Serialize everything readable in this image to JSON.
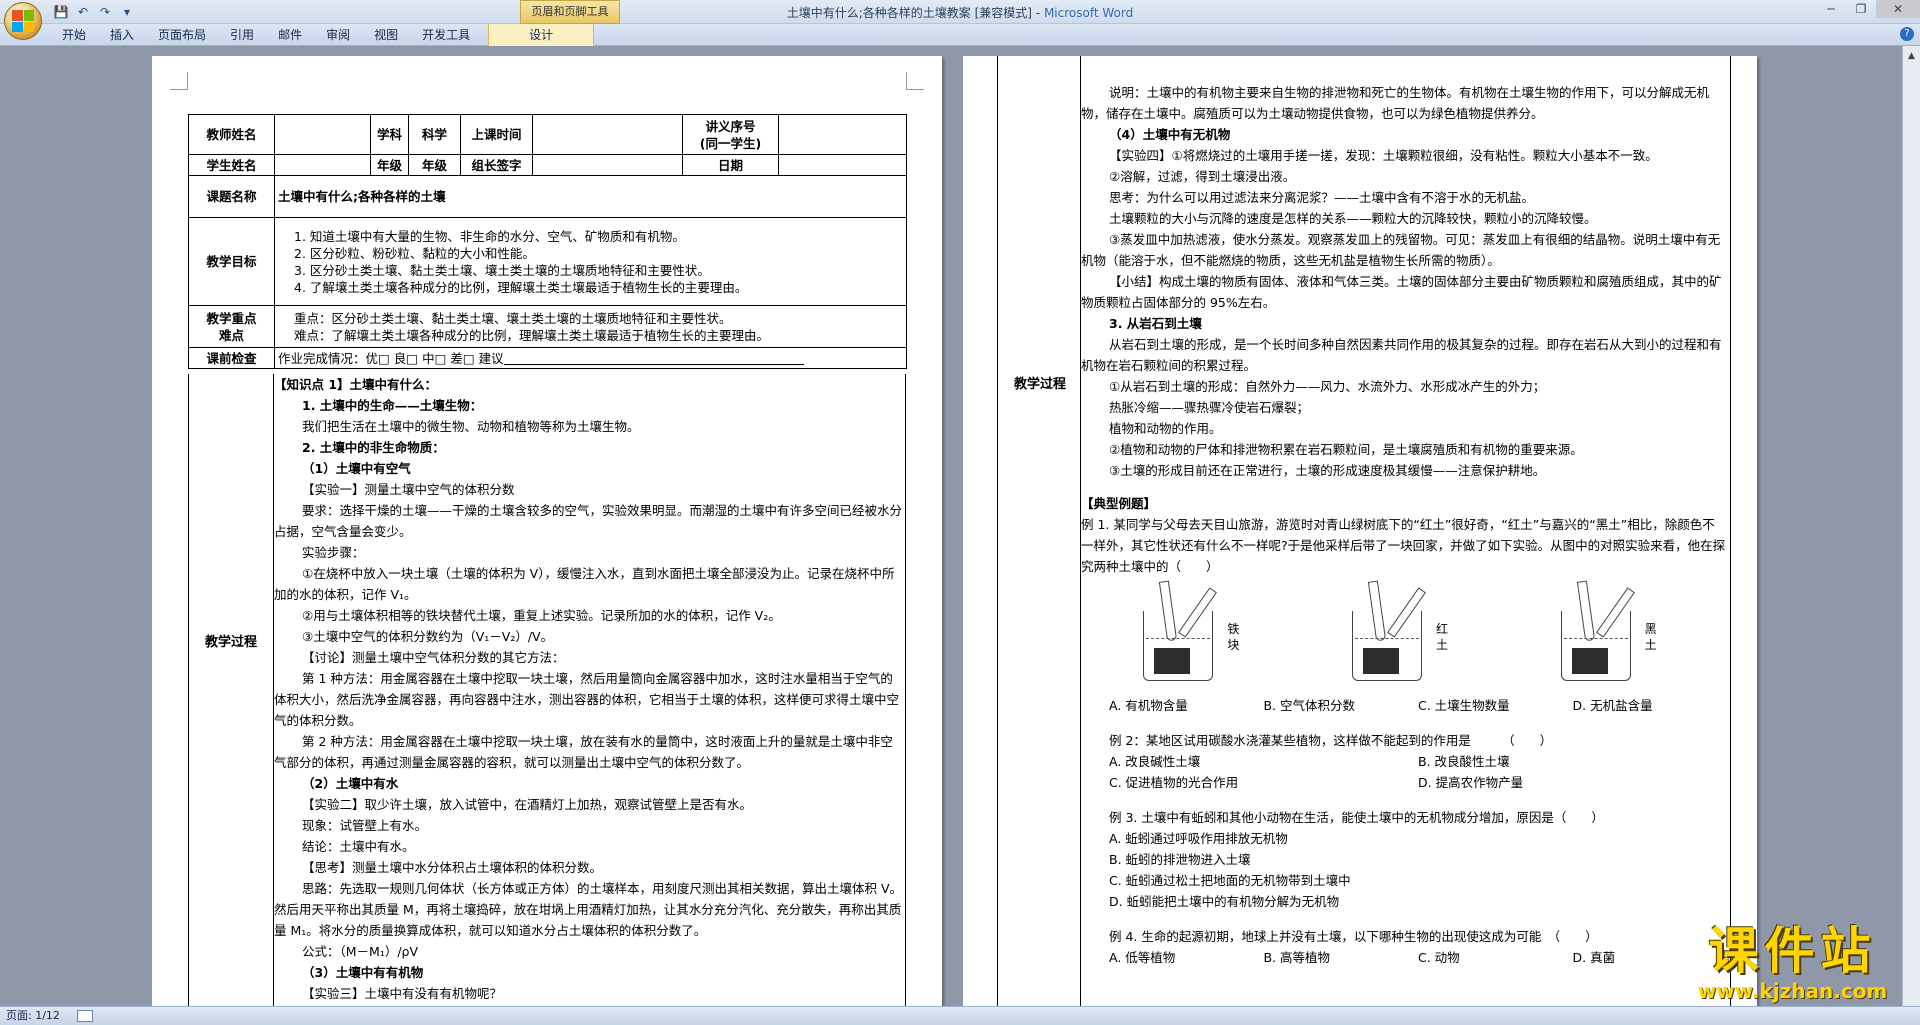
{
  "window": {
    "title": "土壤中有什么;各种各样的土壤教案 [兼容模式]",
    "app_name": "Microsoft Word",
    "separator": " - ",
    "context_group": "页眉和页脚工具",
    "controls": {
      "minimize": "─",
      "restore": "❐",
      "close": "✕"
    }
  },
  "qat": {
    "save": "💾",
    "undo": "↶",
    "redo": "↷",
    "more": "▾"
  },
  "ribbon": {
    "tabs": [
      "开始",
      "插入",
      "页面布局",
      "引用",
      "邮件",
      "审阅",
      "视图",
      "开发工具"
    ],
    "context_tab": "设计",
    "help": "?"
  },
  "status": {
    "page": "页面: 1/12"
  },
  "page1": {
    "header": {
      "teacher_label": "教师姓名",
      "subject_label": "学科",
      "subject_value": "科学",
      "time_label": "上课时间",
      "serial_label_1": "讲义序号",
      "serial_label_2": "(同一学生)",
      "student_label": "学生姓名",
      "grade_label": "年级",
      "grade_value": "年级",
      "leader_label": "组长签字",
      "date_label": "日期",
      "topic_label": "课题名称",
      "topic_value": "土壤中有什么;各种各样的土壤",
      "goals_label": "教学目标",
      "goals": [
        "1. 知道土壤中有大量的生物、非生命的水分、空气、矿物质和有机物。",
        "2. 区分砂粒、粉砂粒、黏粒的大小和性能。",
        "3. 区分砂土类土壤、黏土类土壤、壤土类土壤的土壤质地特征和主要性状。",
        "4. 了解壤土类土壤各种成分的比例，理解壤土类土壤最适于植物生长的主要理由。"
      ],
      "key_label": "教学重点",
      "diff_label": "难点",
      "key_value": "重点：区分砂土类土壤、黏土类土壤、壤土类土壤的土壤质地特征和主要性状。",
      "diff_value": "难点：了解壤土类土壤各种成分的比例，理解壤土类土壤最适于植物生长的主要理由。",
      "precheck_label": "课前检查",
      "precheck_value": "作业完成情况：优□ 良□ 中□ 差□ 建议",
      "process_label": "教学过程"
    },
    "body": [
      {
        "t": "【知识点 1】土壤中有什么：",
        "c": "sec"
      },
      {
        "t": "1. 土壤中的生命——土壤生物：",
        "c": "sec ind2"
      },
      {
        "t": "我们把生活在土壤中的微生物、动物和植物等称为土壤生物。",
        "c": "ind"
      },
      {
        "t": "2. 土壤中的非生命物质：",
        "c": "sec ind2"
      },
      {
        "t": "（1）土壤中有空气",
        "c": "sec ind"
      },
      {
        "t": "【实验一】测量土壤中空气的体积分数",
        "c": "ind"
      },
      {
        "t": "要求：选择干燥的土壤——干燥的土壤含较多的空气，实验效果明显。而潮湿的土壤中有许多空间已经被水分占据，空气含量会变少。",
        "c": "ind"
      },
      {
        "t": "实验步骤：",
        "c": "ind"
      },
      {
        "t": "①在烧杯中放入一块土壤（土壤的体积为 V），缓慢注入水，直到水面把土壤全部浸没为止。记录在烧杯中所加的水的体积，记作 V₁。",
        "c": "ind"
      },
      {
        "t": "②用与土壤体积相等的铁块替代土壤，重复上述实验。记录所加的水的体积，记作 V₂。",
        "c": "ind"
      },
      {
        "t": "③土壤中空气的体积分数约为（V₁－V₂）/V。",
        "c": "ind"
      },
      {
        "t": "【讨论】测量土壤中空气体积分数的其它方法：",
        "c": "ind"
      },
      {
        "t": "第 1 种方法：用金属容器在土壤中挖取一块土壤，然后用量筒向金属容器中加水，这时注水量相当于空气的体积大小，然后洗净金属容器，再向容器中注水，测出容器的体积，它相当于土壤的体积，这样便可求得土壤中空气的体积分数。",
        "c": "ind"
      },
      {
        "t": "第 2 种方法：用金属容器在土壤中挖取一块土壤，放在装有水的量筒中，这时液面上升的量就是土壤中非空气部分的体积，再通过测量金属容器的容积，就可以测量出土壤中空气的体积分数了。",
        "c": "ind"
      },
      {
        "t": "（2）土壤中有水",
        "c": "sec ind"
      },
      {
        "t": "【实验二】取少许土壤，放入试管中，在酒精灯上加热，观察试管壁上是否有水。",
        "c": "ind"
      },
      {
        "t": "现象：试管壁上有水。",
        "c": "ind"
      },
      {
        "t": "结论：土壤中有水。",
        "c": "ind"
      },
      {
        "t": "【思考】测量土壤中水分体积占土壤体积的体积分数。",
        "c": "ind"
      },
      {
        "t": "思路：先选取一规则几何体状（长方体或正方体）的土壤样本，用刻度尺测出其相关数据，算出土壤体积 V。然后用天平称出其质量 M，再将土壤捣碎，放在坩埚上用酒精灯加热，让其水分充分汽化、充分散失，再称出其质量 M₁。将水分的质量换算成体积，就可以知道水分占土壤体积的体积分数了。",
        "c": "ind"
      },
      {
        "t": "公式：（M－M₁）/ρV",
        "c": "ind"
      },
      {
        "t": "（3）土壤中有有机物",
        "c": "sec ind"
      },
      {
        "t": "【实验三】土壤中有没有有机物呢？",
        "c": "ind"
      }
    ]
  },
  "page2": {
    "process_label": "教学过程",
    "body": [
      {
        "t": "说明：土壤中的有机物主要来自生物的排泄物和死亡的生物体。有机物在土壤生物的作用下，可以分解成无机物，储存在土壤中。腐殖质可以为土壤动物提供食物，也可以为绿色植物提供养分。",
        "c": "ind"
      },
      {
        "t": "（4）土壤中有无机物",
        "c": "sec ind"
      },
      {
        "t": "【实验四】①将燃烧过的土壤用手搓一搓，发现：土壤颗粒很细，没有粘性。颗粒大小基本不一致。",
        "c": "ind"
      },
      {
        "t": "②溶解，过滤，得到土壤浸出液。",
        "c": "ind"
      },
      {
        "t": "思考：为什么可以用过滤法来分离泥浆？——土壤中含有不溶于水的无机盐。",
        "c": "ind"
      },
      {
        "t": "土壤颗粒的大小与沉降的速度是怎样的关系——颗粒大的沉降较快，颗粒小的沉降较慢。",
        "c": "ind"
      },
      {
        "t": "③蒸发皿中加热滤液，使水分蒸发。观察蒸发皿上的残留物。可见：蒸发皿上有很细的结晶物。说明土壤中有无机物（能溶于水，但不能燃烧的物质，这些无机盐是植物生长所需的物质）。",
        "c": "ind"
      },
      {
        "t": "【小结】构成土壤的物质有固体、液体和气体三类。土壤的固体部分主要由矿物质颗粒和腐殖质组成，其中的矿物质颗粒占固体部分的 95%左右。",
        "c": "ind"
      },
      {
        "t": "3. 从岩石到土壤",
        "c": "sec ind2"
      },
      {
        "t": "从岩石到土壤的形成，是一个长时间多种自然因素共同作用的极其复杂的过程。即存在岩石从大到小的过程和有机物在岩石颗粒间的积累过程。",
        "c": "ind"
      },
      {
        "t": "①从岩石到土壤的形成：自然外力——风力、水流外力、水形成冰产生的外力；",
        "c": "ind"
      },
      {
        "t": "热胀冷缩——骤热骤冷使岩石爆裂；",
        "c": "ind"
      },
      {
        "t": "植物和动物的作用。",
        "c": "ind"
      },
      {
        "t": "②植物和动物的尸体和排泄物积累在岩石颗粒间，是土壤腐殖质和有机物的重要来源。",
        "c": "ind"
      },
      {
        "t": "③土壤的形成目前还在正常进行，土壤的形成速度极其缓慢——注意保护耕地。",
        "c": "ind"
      }
    ],
    "examples_title": "【典型例题】",
    "ex1": "例 1. 某同学与父母去天目山旅游，游览时对青山绿树底下的“红土”很好奇，“红土”与嘉兴的“黑土”相比，除颜色不一样外，其它性状还有什么不一样呢?于是他采样后带了一块回家，并做了如下实验。从图中的对照实验来看，他在探究两种土壤中的（　　）",
    "fig_labels": [
      "铁块",
      "红土",
      "黑土"
    ],
    "ex1_choices": [
      "A. 有机物含量",
      "B. 空气体积分数",
      "C. 土壤生物数量",
      "D. 无机盐含量"
    ],
    "ex2": "例 2：某地区试用碳酸水浇灌某些植物，这样做不能起到的作用是　　　（　　）",
    "ex2_choices": [
      "A. 改良碱性土壤",
      "B. 改良酸性土壤",
      "C. 促进植物的光合作用",
      "D. 提高农作物产量"
    ],
    "ex3": "例 3. 土壤中有蚯蚓和其他小动物在生活，能使土壤中的无机物成分增加，原因是（　　）",
    "ex3_choices": [
      "A. 蚯蚓通过呼吸作用排放无机物",
      "B. 蚯蚓的排泄物进入土壤",
      "C. 蚯蚓通过松土把地面的无机物带到土壤中",
      "D. 蚯蚓能把土壤中的有机物分解为无机物"
    ],
    "ex4": "例 4. 生命的起源初期，地球上并没有土壤，以下哪种生物的出现使这成为可能　（　　）",
    "ex4_choices": [
      "A. 低等植物",
      "B. 高等植物",
      "C. 动物",
      "D. 真菌"
    ]
  },
  "watermark": {
    "cn": "课件站",
    "url": "www.kjzhan.com"
  },
  "colors": {
    "ribbon": "#c7d6ea",
    "workspace": "#8e98a8",
    "accent": "#3468b2",
    "watermark": "#ffd400"
  },
  "marks": {
    "para": "↵"
  }
}
